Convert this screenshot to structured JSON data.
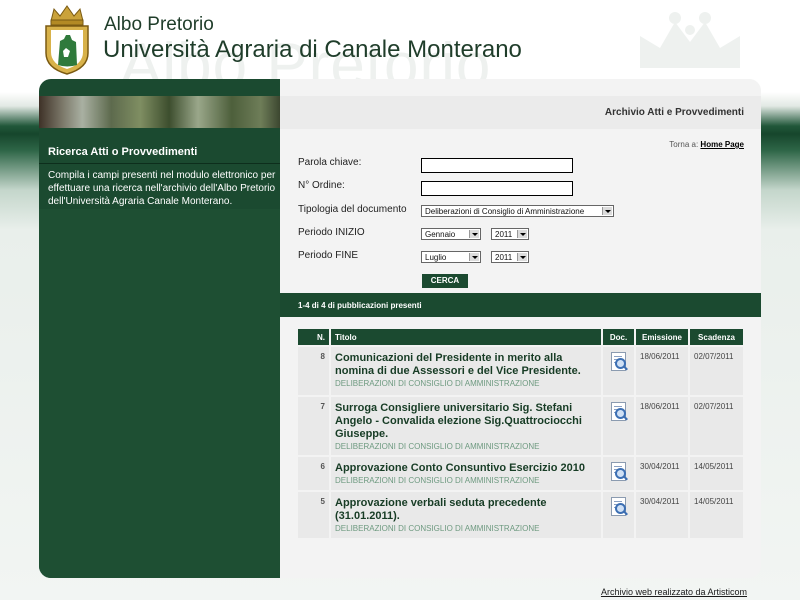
{
  "header": {
    "title_small": "Albo Pretorio",
    "title_big": "Università Agraria di Canale Monterano",
    "watermark": "Albo Pretorio"
  },
  "sidebar": {
    "title": "Ricerca Atti o Provvedimenti",
    "description": "Compila i campi presenti nel modulo elettronico per effettuare una ricerca nell'archivio dell'Albo Pretorio dell'Università Agraria Canale Monterano."
  },
  "main": {
    "section_title": "Archivio Atti e Provvedimenti",
    "back_prefix": "Torna a:",
    "back_link": "Home Page"
  },
  "form": {
    "keyword_label": "Parola chiave:",
    "keyword_value": "",
    "order_label": "N° Ordine:",
    "order_value": "",
    "doctype_label": "Tipologia del documento",
    "doctype_value": "Deliberazioni di Consiglio di Amministrazione",
    "start_label": "Periodo INIZIO",
    "start_month": "Gennaio",
    "start_year": "2011",
    "end_label": "Periodo FINE",
    "end_month": "Luglio",
    "end_year": "2011",
    "search_button": "CERCA"
  },
  "results": {
    "summary": "1-4 di 4 di pubblicazioni presenti",
    "columns": {
      "n": "N.",
      "title": "Titolo",
      "doc": "Doc.",
      "issued": "Emissione",
      "expiry": "Scadenza"
    },
    "rows": [
      {
        "n": "8",
        "title": "Comunicazioni del Presidente in merito alla nomina di due Assessori e del Vice Presidente.",
        "category": "DELIBERAZIONI DI CONSIGLIO DI AMMINISTRAZIONE",
        "issued": "18/06/2011",
        "expiry": "02/07/2011"
      },
      {
        "n": "7",
        "title": "Surroga Consigliere universitario Sig. Stefani Angelo - Convalida elezione Sig.Quattrociocchi Giuseppe.",
        "category": "DELIBERAZIONI DI CONSIGLIO DI AMMINISTRAZIONE",
        "issued": "18/06/2011",
        "expiry": "02/07/2011"
      },
      {
        "n": "6",
        "title": "Approvazione Conto Consuntivo Esercizio 2010",
        "category": "DELIBERAZIONI DI CONSIGLIO DI AMMINISTRAZIONE",
        "issued": "30/04/2011",
        "expiry": "14/05/2011"
      },
      {
        "n": "5",
        "title": "Approvazione verbali seduta precedente (31.01.2011).",
        "category": "DELIBERAZIONI DI CONSIGLIO DI AMMINISTRAZIONE",
        "issued": "30/04/2011",
        "expiry": "14/05/2011"
      }
    ]
  },
  "footer": {
    "credit": "Archivio web realizzato da Artisticom"
  },
  "icons": {
    "logo": "crest-logo",
    "document": "document-magnifier-icon",
    "dropdown": "dropdown-arrow-icon"
  },
  "colors": {
    "brand_green": "#1b4a30",
    "title_green": "#173c25",
    "category_green": "#6e9a80"
  }
}
